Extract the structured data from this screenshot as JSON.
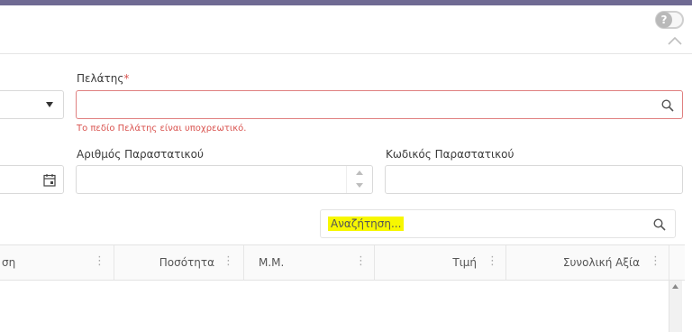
{
  "help": {
    "icon_text": "?"
  },
  "form": {
    "customer": {
      "label": "Πελάτης",
      "required_mark": "*",
      "value": "",
      "error": "Το πεδίο Πελάτης είναι υποχρεωτικό."
    },
    "document_number": {
      "label": "Αριθμός Παραστατικού",
      "value": ""
    },
    "document_code": {
      "label": "Κωδικός Παραστατικού",
      "value": ""
    }
  },
  "grid": {
    "search_placeholder": "Αναζήτηση...",
    "columns": [
      {
        "label": "ση"
      },
      {
        "label": "Ποσότητα"
      },
      {
        "label": "Μ.Μ."
      },
      {
        "label": "Τιμή"
      },
      {
        "label": "Συνολική Αξία"
      }
    ]
  },
  "colors": {
    "top_bar": "#6f6a93",
    "error": "#d9534f",
    "highlight": "#f7f700"
  }
}
